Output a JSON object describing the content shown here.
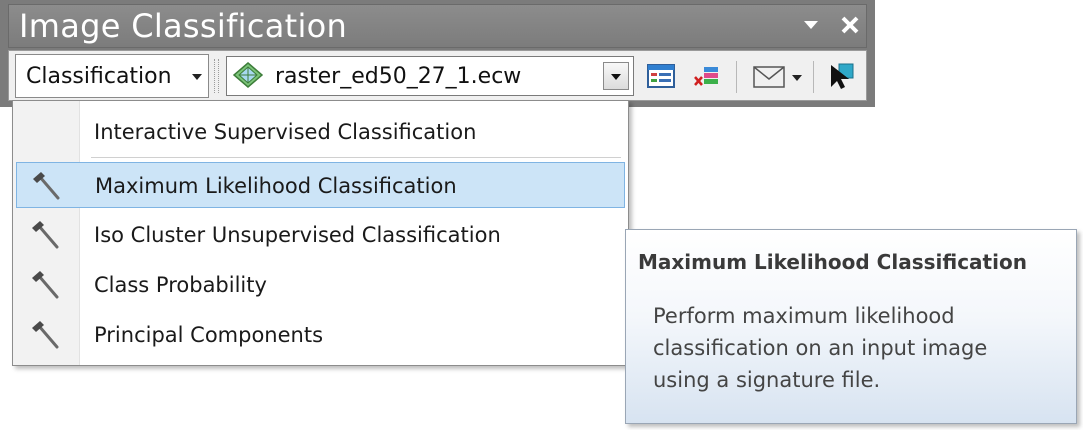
{
  "window": {
    "title": "Image Classification"
  },
  "toolbar": {
    "classification_label": "Classification",
    "layer_select": {
      "value": "raster_ed50_27_1.ecw"
    }
  },
  "menu": {
    "items": [
      {
        "label": "Interactive Supervised Classification",
        "icon": "none"
      },
      {
        "label": "Maximum Likelihood Classification",
        "icon": "hammer-icon",
        "highlighted": true
      },
      {
        "label": "Iso Cluster Unsupervised Classification",
        "icon": "hammer-icon"
      },
      {
        "label": "Class Probability",
        "icon": "hammer-icon"
      },
      {
        "label": "Principal Components",
        "icon": "hammer-icon"
      }
    ]
  },
  "tooltip": {
    "title": "Maximum Likelihood Classification",
    "line1": "Perform maximum likelihood",
    "line2": "classification on an input image",
    "line3": "using a signature file."
  },
  "colors": {
    "title_bar": "#7b7b7b",
    "highlight": "#cce4f7",
    "highlight_border": "#7fb4e3"
  }
}
